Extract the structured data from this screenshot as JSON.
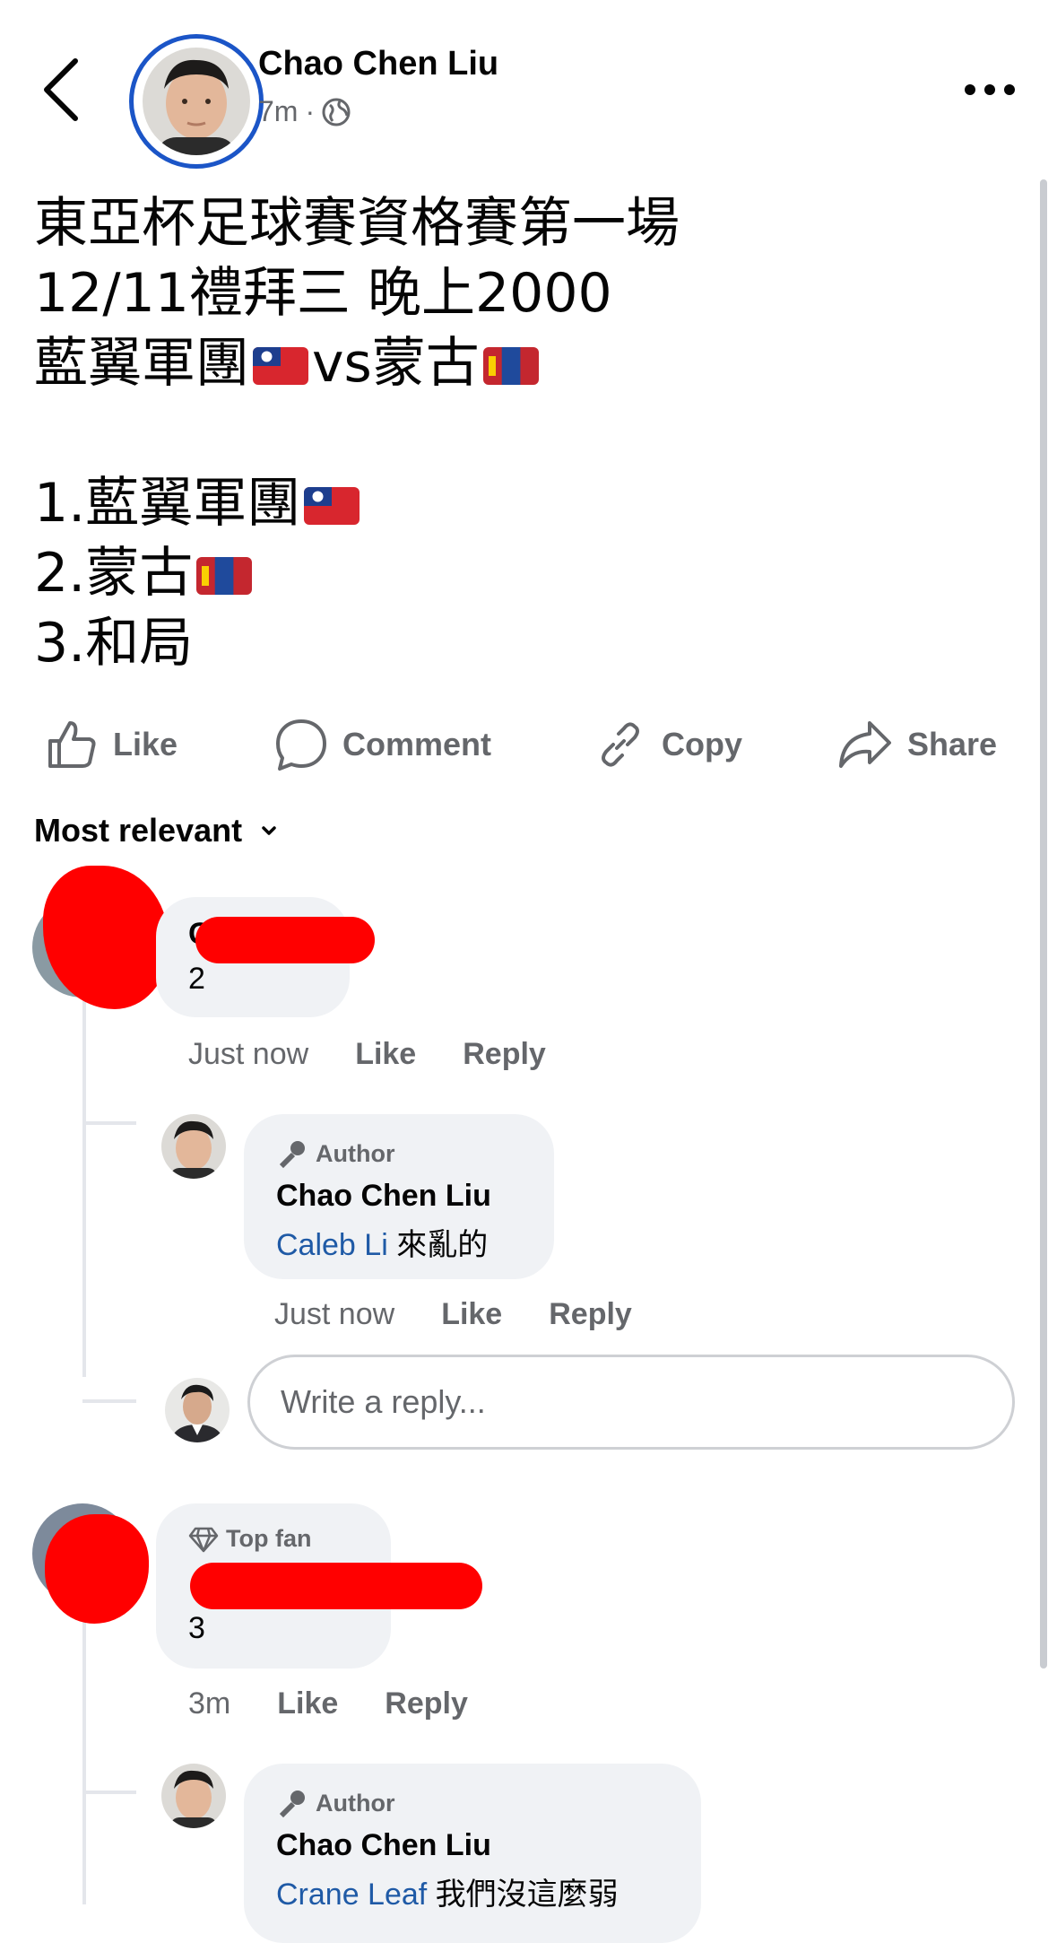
{
  "header": {
    "author_name": "Chao Chen Liu",
    "time": "7m",
    "separator": "·",
    "privacy_icon": "globe-icon",
    "back_icon": "chevron-left-icon",
    "more_icon": "more-horizontal-icon"
  },
  "post": {
    "line1": "東亞杯足球賽資格賽第一場",
    "line2": "12/11禮拜三 晚上2000",
    "line3_a": "藍翼軍團",
    "line3_vs": "vs",
    "line3_b": "蒙古",
    "opt1": "1.藍翼軍團",
    "opt2": "2.蒙古",
    "opt3": "3.和局",
    "flag_tw": "taiwan-flag-icon",
    "flag_mn": "mongolia-flag-icon"
  },
  "actions": {
    "like": "Like",
    "comment": "Comment",
    "copy": "Copy",
    "share": "Share"
  },
  "sort": {
    "label": "Most relevant",
    "icon": "chevron-down-icon"
  },
  "comments": [
    {
      "name_visible": "C",
      "text": "2",
      "time": "Just now",
      "like": "Like",
      "reply": "Reply",
      "replies": [
        {
          "badge": "Author",
          "name": "Chao Chen Liu",
          "mention": "Caleb Li",
          "text": " 來亂的",
          "time": "Just now",
          "like": "Like",
          "reply": "Reply"
        }
      ],
      "reply_placeholder": "Write a reply..."
    },
    {
      "badge": "Top fan",
      "text": "3",
      "time": "3m",
      "like": "Like",
      "reply": "Reply",
      "replies": [
        {
          "badge": "Author",
          "name": "Chao Chen Liu",
          "mention": "Crane Leaf",
          "text": " 我們沒這麼弱"
        }
      ]
    }
  ],
  "colors": {
    "accent_ring": "#1b55c7",
    "mention": "#1f5aa6",
    "secondary_text": "#65676b",
    "bubble": "#f0f2f5",
    "redaction": "#ff0000"
  }
}
